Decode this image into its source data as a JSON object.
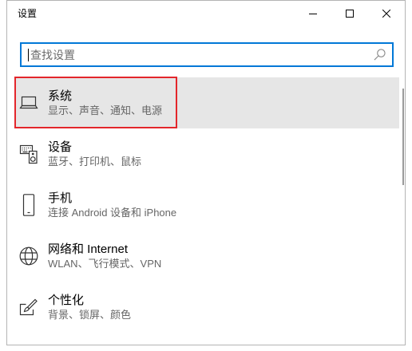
{
  "window": {
    "title": "设置",
    "controls": {
      "minimize_icon": "minimize-icon",
      "maximize_icon": "maximize-icon",
      "close_icon": "close-icon"
    }
  },
  "search": {
    "placeholder": "查找设置",
    "value": "",
    "icon": "search-icon"
  },
  "categories": [
    {
      "title": "系统",
      "subtitle": "显示、声音、通知、电源",
      "icon": "laptop-icon",
      "highlighted": true
    },
    {
      "title": "设备",
      "subtitle": "蓝牙、打印机、鼠标",
      "icon": "devices-icon",
      "highlighted": false
    },
    {
      "title": "手机",
      "subtitle": "连接 Android 设备和 iPhone",
      "icon": "phone-icon",
      "highlighted": false
    },
    {
      "title": "网络和 Internet",
      "subtitle": "WLAN、飞行模式、VPN",
      "icon": "globe-icon",
      "highlighted": false
    },
    {
      "title": "个性化",
      "subtitle": "背景、锁屏、颜色",
      "icon": "personalization-icon",
      "highlighted": false
    }
  ],
  "colors": {
    "accent": "#0078d7",
    "highlight_row": "#e6e6e6",
    "annotation": "#e3262b",
    "text": "#000000",
    "subtext": "#666666"
  }
}
